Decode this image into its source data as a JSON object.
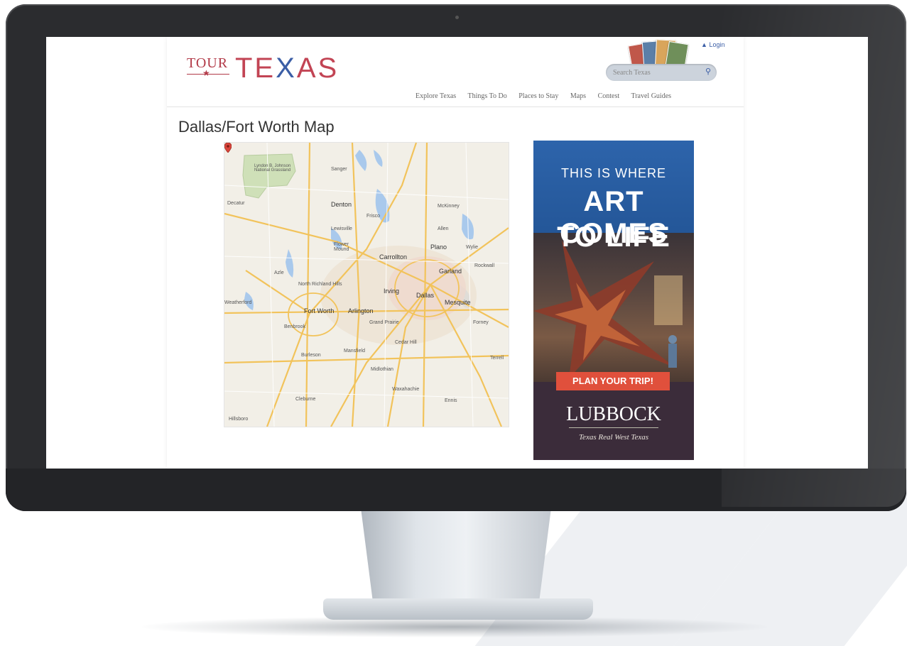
{
  "header": {
    "logo_tour": "TOUR",
    "logo_texas_pre": "TE",
    "logo_texas_x": "X",
    "logo_texas_post": "AS",
    "login_label": "Login",
    "search_placeholder": "Search Texas"
  },
  "nav": {
    "items": [
      "Explore Texas",
      "Things To Do",
      "Places to Stay",
      "Maps",
      "Contest",
      "Travel Guides"
    ]
  },
  "main": {
    "title": "Dallas/Fort Worth Map"
  },
  "map": {
    "labels": {
      "denton": "Denton",
      "frisco": "Frisco",
      "mckinney": "McKinney",
      "plano": "Plano",
      "carrollton": "Carrollton",
      "flower_mound": "Flower Mound",
      "lewisville": "Lewisville",
      "garland": "Garland",
      "irving": "Irving",
      "dallas": "Dallas",
      "mesquite": "Mesquite",
      "fort_worth": "Fort Worth",
      "arlington": "Arlington",
      "grand_prairie": "Grand Prairie",
      "north_richland_hills": "North Richland Hills",
      "mansfield": "Mansfield",
      "burleson": "Burleson",
      "waxahachie": "Waxahachie",
      "cleburne": "Cleburne",
      "weatherford": "Weatherford",
      "decatur": "Decatur",
      "rockwall": "Rockwall",
      "allen": "Allen",
      "lbj_grasslands": "Lyndon B. Johnson National Grassland",
      "sanger": "Sanger",
      "ennis": "Ennis",
      "midlothian": "Midlothian",
      "cedar_hill": "Cedar Hill",
      "terrell": "Terrell",
      "forney": "Forney",
      "wylie": "Wylie",
      "azle": "Azle",
      "benbrook": "Benbrook",
      "hillsboro": "Hillsboro"
    }
  },
  "ad": {
    "line1": "THIS IS WHERE",
    "line2": "ART COMES",
    "line3": "TO LIFE",
    "cta": "PLAN YOUR TRIP!",
    "brand": "LUBBOCK",
    "tagline": "Texas Real West Texas"
  }
}
